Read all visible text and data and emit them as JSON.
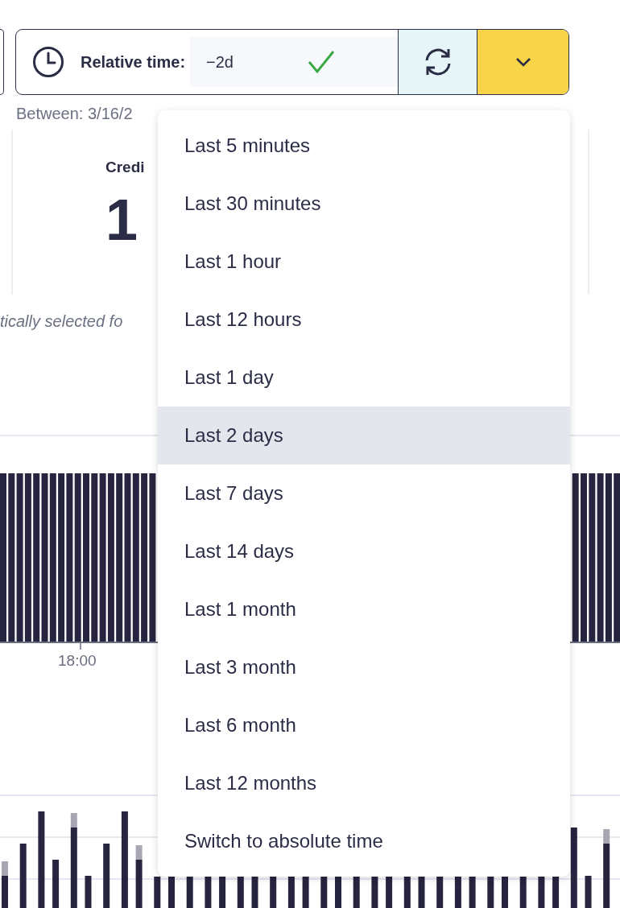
{
  "time_picker": {
    "label": "Relative time:",
    "value": "−2d",
    "valid": true
  },
  "range_text": "Between: 3/16/2",
  "stat": {
    "label": "Credi",
    "value": "1"
  },
  "note": "tically selected fo",
  "chart": {
    "x_label": "18:00"
  },
  "menu": [
    {
      "label": "Last 5 minutes",
      "selected": false
    },
    {
      "label": "Last 30 minutes",
      "selected": false
    },
    {
      "label": "Last 1 hour",
      "selected": false
    },
    {
      "label": "Last 12 hours",
      "selected": false
    },
    {
      "label": "Last 1 day",
      "selected": false
    },
    {
      "label": "Last 2 days",
      "selected": true
    },
    {
      "label": "Last 7 days",
      "selected": false
    },
    {
      "label": "Last 14 days",
      "selected": false
    },
    {
      "label": "Last 1 month",
      "selected": false
    },
    {
      "label": "Last 3 month",
      "selected": false
    },
    {
      "label": "Last 6 month",
      "selected": false
    },
    {
      "label": "Last 12 months",
      "selected": false
    },
    {
      "label": "Switch to absolute time",
      "selected": false
    }
  ]
}
